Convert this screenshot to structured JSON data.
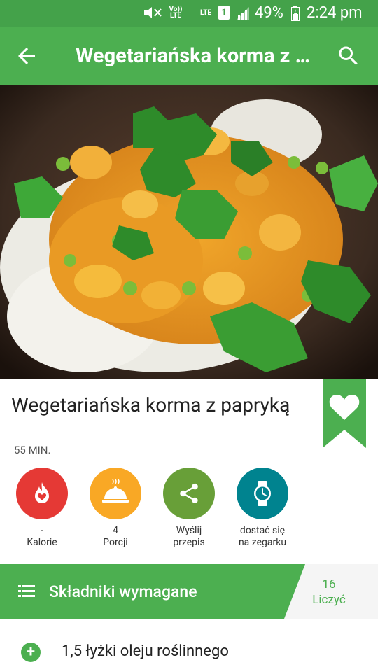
{
  "status_bar": {
    "volte": "Vo)) LTE",
    "lte": "LTE",
    "sim": "1",
    "battery": "49%",
    "time": "2:24 pm"
  },
  "toolbar": {
    "title": "Wegetariańska korma z papryką",
    "back_icon": "arrow-back-icon",
    "search_icon": "search-icon"
  },
  "recipe": {
    "title": "Wegetariańska korma z papryką",
    "time": "55 MIN."
  },
  "actions": [
    {
      "line1": "-",
      "line2": "Kalorie",
      "color": "#e53935",
      "icon": "calorie-flame-icon"
    },
    {
      "line1": "4",
      "line2": "Porcji",
      "color": "#f9a825",
      "icon": "serving-dish-icon"
    },
    {
      "line1": "Wyślij",
      "line2": "przepis",
      "color": "#689f38",
      "icon": "share-icon"
    },
    {
      "line1": "dostać się",
      "line2": "na zegarku",
      "color": "#00838f",
      "icon": "watch-icon"
    }
  ],
  "ingredients": {
    "header": "Składniki wymagane",
    "count": "16",
    "count_label": "Liczyć",
    "items": [
      "1,5 łyżki oleju roślinnego"
    ]
  },
  "colors": {
    "status_bar": "#44a24a",
    "toolbar": "#4caf50",
    "accent": "#4caf50"
  }
}
